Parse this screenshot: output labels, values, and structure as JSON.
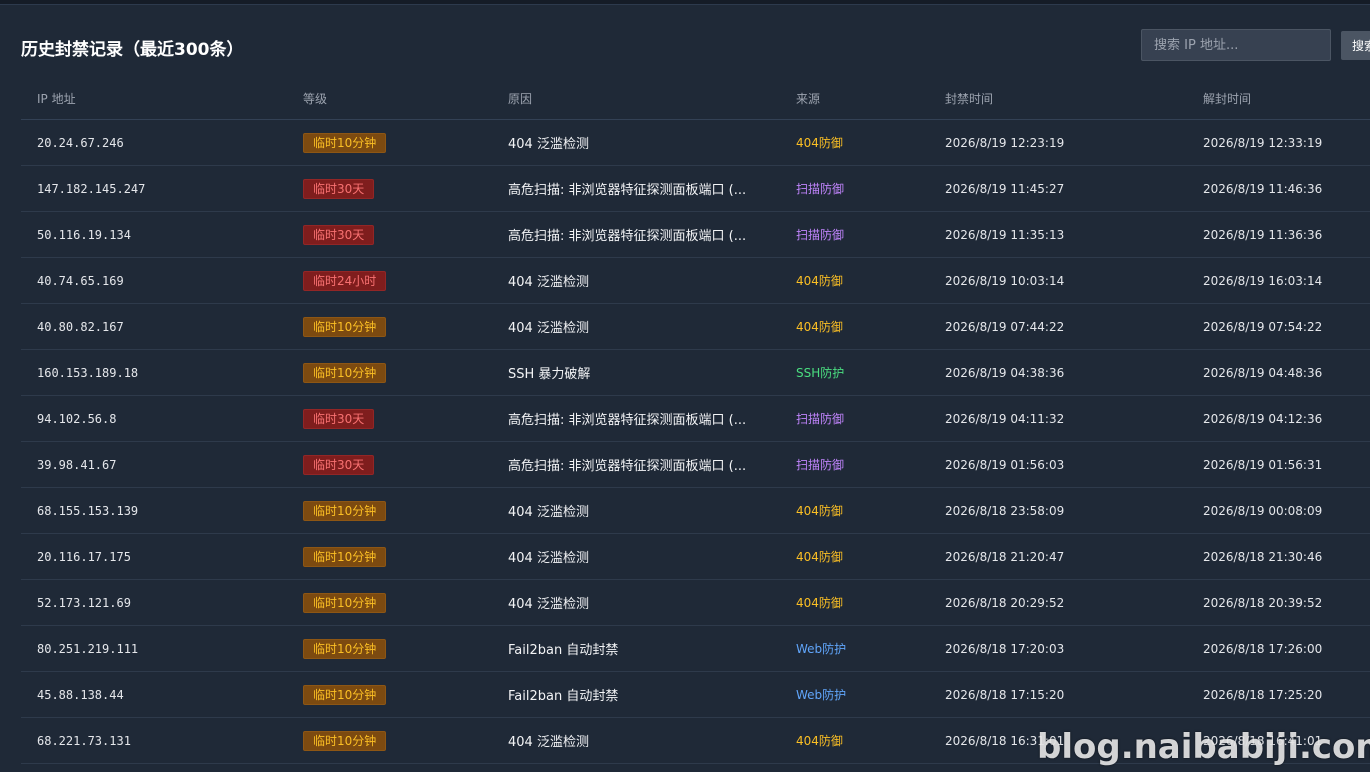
{
  "page": {
    "title": "历史封禁记录（最近300条）"
  },
  "search": {
    "placeholder": "搜索 IP 地址...",
    "button_label": "搜索"
  },
  "table": {
    "columns": [
      "IP 地址",
      "等级",
      "原因",
      "来源",
      "封禁时间",
      "解封时间"
    ],
    "rows": [
      {
        "ip": "20.24.67.246",
        "level": "临时10分钟",
        "level_type": "warn",
        "reason": "404 泛滥检测",
        "source": "404防御",
        "source_type": "c404",
        "ban_time": "2026/8/19 12:23:19",
        "unban_time": "2026/8/19 12:33:19"
      },
      {
        "ip": "147.182.145.247",
        "level": "临时30天",
        "level_type": "danger",
        "reason": "高危扫描: 非浏览器特征探测面板端口 (...",
        "source": "扫描防御",
        "source_type": "scan",
        "ban_time": "2026/8/19 11:45:27",
        "unban_time": "2026/8/19 11:46:36"
      },
      {
        "ip": "50.116.19.134",
        "level": "临时30天",
        "level_type": "danger",
        "reason": "高危扫描: 非浏览器特征探测面板端口 (...",
        "source": "扫描防御",
        "source_type": "scan",
        "ban_time": "2026/8/19 11:35:13",
        "unban_time": "2026/8/19 11:36:36"
      },
      {
        "ip": "40.74.65.169",
        "level": "临时24小时",
        "level_type": "danger",
        "reason": "404 泛滥检测",
        "source": "404防御",
        "source_type": "c404",
        "ban_time": "2026/8/19 10:03:14",
        "unban_time": "2026/8/19 16:03:14"
      },
      {
        "ip": "40.80.82.167",
        "level": "临时10分钟",
        "level_type": "warn",
        "reason": "404 泛滥检测",
        "source": "404防御",
        "source_type": "c404",
        "ban_time": "2026/8/19 07:44:22",
        "unban_time": "2026/8/19 07:54:22"
      },
      {
        "ip": "160.153.189.18",
        "level": "临时10分钟",
        "level_type": "warn",
        "reason": "SSH 暴力破解",
        "source": "SSH防护",
        "source_type": "ssh",
        "ban_time": "2026/8/19 04:38:36",
        "unban_time": "2026/8/19 04:48:36"
      },
      {
        "ip": "94.102.56.8",
        "level": "临时30天",
        "level_type": "danger",
        "reason": "高危扫描: 非浏览器特征探测面板端口 (...",
        "source": "扫描防御",
        "source_type": "scan",
        "ban_time": "2026/8/19 04:11:32",
        "unban_time": "2026/8/19 04:12:36"
      },
      {
        "ip": "39.98.41.67",
        "level": "临时30天",
        "level_type": "danger",
        "reason": "高危扫描: 非浏览器特征探测面板端口 (...",
        "source": "扫描防御",
        "source_type": "scan",
        "ban_time": "2026/8/19 01:56:03",
        "unban_time": "2026/8/19 01:56:31"
      },
      {
        "ip": "68.155.153.139",
        "level": "临时10分钟",
        "level_type": "warn",
        "reason": "404 泛滥检测",
        "source": "404防御",
        "source_type": "c404",
        "ban_time": "2026/8/18 23:58:09",
        "unban_time": "2026/8/19 00:08:09"
      },
      {
        "ip": "20.116.17.175",
        "level": "临时10分钟",
        "level_type": "warn",
        "reason": "404 泛滥检测",
        "source": "404防御",
        "source_type": "c404",
        "ban_time": "2026/8/18 21:20:47",
        "unban_time": "2026/8/18 21:30:46"
      },
      {
        "ip": "52.173.121.69",
        "level": "临时10分钟",
        "level_type": "warn",
        "reason": "404 泛滥检测",
        "source": "404防御",
        "source_type": "c404",
        "ban_time": "2026/8/18 20:29:52",
        "unban_time": "2026/8/18 20:39:52"
      },
      {
        "ip": "80.251.219.111",
        "level": "临时10分钟",
        "level_type": "warn",
        "reason": "Fail2ban 自动封禁",
        "source": "Web防护",
        "source_type": "web",
        "ban_time": "2026/8/18 17:20:03",
        "unban_time": "2026/8/18 17:26:00"
      },
      {
        "ip": "45.88.138.44",
        "level": "临时10分钟",
        "level_type": "warn",
        "reason": "Fail2ban 自动封禁",
        "source": "Web防护",
        "source_type": "web",
        "ban_time": "2026/8/18 17:15:20",
        "unban_time": "2026/8/18 17:25:20"
      },
      {
        "ip": "68.221.73.131",
        "level": "临时10分钟",
        "level_type": "warn",
        "reason": "404 泛滥检测",
        "source": "404防御",
        "source_type": "c404",
        "ban_time": "2026/8/18 16:31:01",
        "unban_time": "2026/8/18 16:41:01"
      }
    ]
  },
  "watermark": "blog.naibabiji.com",
  "colors": {
    "background": "#1f2937",
    "badge_warn_bg": "#7c4a10",
    "badge_warn_text": "#fbbf24",
    "badge_danger_bg": "#7f1d1d",
    "badge_danger_text": "#f87171",
    "source_404": "#fbbf24",
    "source_scan": "#c084fc",
    "source_ssh": "#4ade80",
    "source_web": "#60a5fa"
  }
}
